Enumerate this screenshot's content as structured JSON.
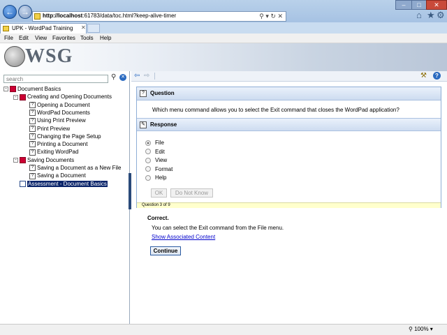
{
  "browser": {
    "address_host": "http://localhost",
    "address_rest": ":61783/data/toc.html?keep-alive-timer",
    "tab_label": "UPK - WordPad Training",
    "menus": [
      "File",
      "Edit",
      "View",
      "Favorites",
      "Tools",
      "Help"
    ],
    "zoom": "100%"
  },
  "banner": {
    "logo_text": "WSG"
  },
  "left": {
    "search_placeholder": "search",
    "tree": [
      {
        "label": "Document Basics",
        "icon": "book",
        "toggle": "-"
      },
      {
        "label": "Creating and Opening Documents",
        "icon": "book",
        "toggle": "-"
      },
      {
        "label": "Opening a Document",
        "icon": "doc"
      },
      {
        "label": "WordPad Documents",
        "icon": "doc"
      },
      {
        "label": "Using Print Preview",
        "icon": "doc"
      },
      {
        "label": "Print Preview",
        "icon": "doc"
      },
      {
        "label": "Changing the Page Setup",
        "icon": "doc"
      },
      {
        "label": "Printing a Document",
        "icon": "doc"
      },
      {
        "label": "Exiting WordPad",
        "icon": "doc"
      },
      {
        "label": "Saving Documents",
        "icon": "book",
        "toggle": "-"
      },
      {
        "label": "Saving a Document as a New File",
        "icon": "doc"
      },
      {
        "label": "Saving a Document",
        "icon": "doc"
      },
      {
        "label": "Assessment - Document Basics",
        "icon": "assess",
        "selected": true
      }
    ]
  },
  "question": {
    "header": "Question",
    "text": "Which menu command allows you to select the Exit command that closes the WordPad application?",
    "response_header": "Response",
    "options": [
      "File",
      "Edit",
      "View",
      "Format",
      "Help"
    ],
    "selected_option": "File",
    "ok_label": "OK",
    "dont_know_label": "Do Not Know",
    "progress": "Question 3 of 9"
  },
  "feedback": {
    "title": "Correct.",
    "text": "You can select the Exit command from the File menu.",
    "link": "Show Associated Content",
    "continue_label": "Continue"
  }
}
